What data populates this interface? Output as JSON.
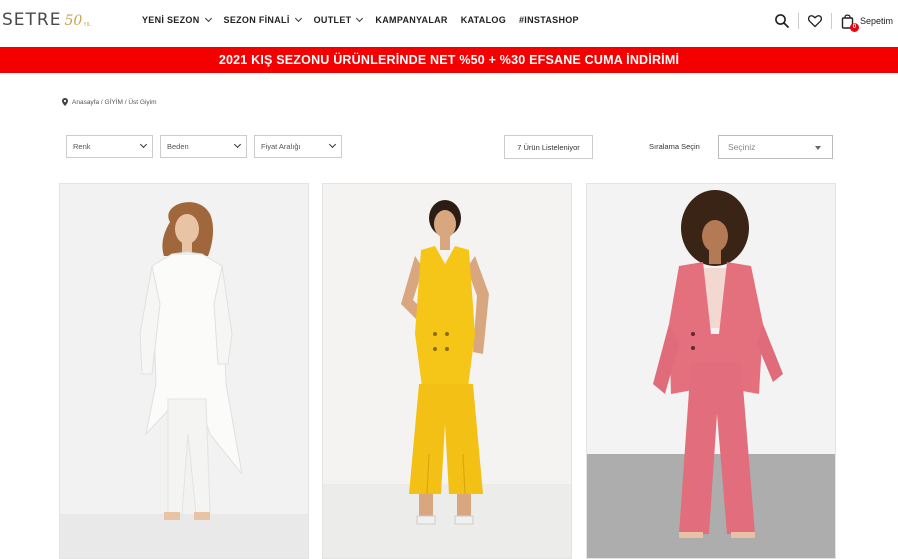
{
  "header": {
    "logo_text": "SETRE",
    "logo_fifty": "50",
    "logo_sub": "YIL",
    "nav": [
      {
        "label": "YENİ SEZON",
        "has_dropdown": true
      },
      {
        "label": "SEZON FİNALİ",
        "has_dropdown": true
      },
      {
        "label": "OUTLET",
        "has_dropdown": true
      },
      {
        "label": "KAMPANYALAR",
        "has_dropdown": false
      },
      {
        "label": "KATALOG",
        "has_dropdown": false
      },
      {
        "label": "#INSTASHOP",
        "has_dropdown": false
      }
    ],
    "cart_label": "Sepetim",
    "cart_count": "0",
    "icons": [
      "search-icon",
      "heart-icon",
      "shopping-bag-icon"
    ]
  },
  "promo": {
    "text": "2021 KIŞ SEZONU ÜRÜNLERİNDE NET %50 + %30 EFSANE CUMA İNDİRİMİ",
    "background": "#f40000"
  },
  "breadcrumb": {
    "text": "Anasayfa / GİYİM / Üst Giyim"
  },
  "filters": {
    "color": "Renk",
    "size": "Beden",
    "price": "Fiyat Aralığı",
    "result_count": "7 Ürün  Listeleniyor",
    "sort_label": "Sıralama Seçin",
    "sort_value": "Seçiniz"
  },
  "products": [
    {
      "image": "model-in-white-blazer-suit",
      "outfit_color": "#f6f6f4"
    },
    {
      "image": "model-in-yellow-vest-suit",
      "outfit_color": "#f5c518"
    },
    {
      "image": "model-in-pink-blazer-suit",
      "outfit_color": "#e4707e"
    }
  ]
}
